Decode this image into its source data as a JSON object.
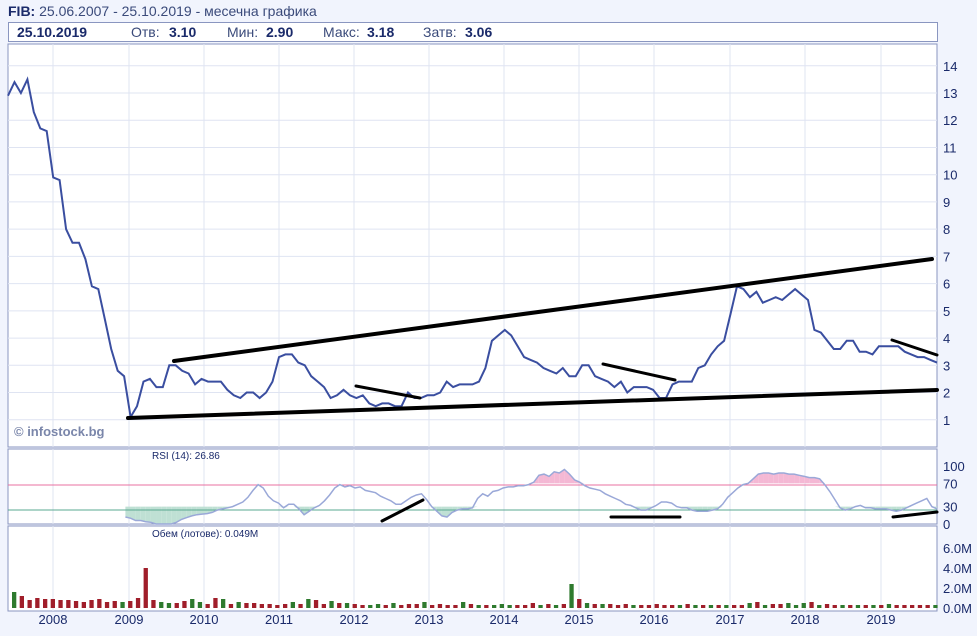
{
  "header": {
    "symbol": "FIB:",
    "range": "25.06.2007 - 25.10.2019 - месечна графика"
  },
  "info_bar": {
    "date": "25.10.2019",
    "open_label": "Отв:",
    "open": "3.10",
    "min_label": "Мин:",
    "min": "2.90",
    "max_label": "Макс:",
    "max": "3.18",
    "close_label": "Затв:",
    "close": "3.06"
  },
  "watermark": "© infostock.bg",
  "rsi_label": "RSI (14): 26.86",
  "volume_label": "Обем (лотове): 0.049M",
  "colors": {
    "price_line": "#3a4ea0",
    "rsi_70": "#e870a0",
    "rsi_30": "#58a890",
    "vol_up": "#2e7a2e",
    "vol_down": "#a01e2a",
    "trend": "#000000"
  },
  "chart_data": [
    {
      "type": "line",
      "title": "",
      "x_axis": [
        "2008",
        "2009",
        "2010",
        "2011",
        "2012",
        "2013",
        "2014",
        "2015",
        "2016",
        "2017",
        "2018",
        "2019"
      ],
      "y_ticks": [
        "1",
        "2",
        "3",
        "4",
        "5",
        "6",
        "7",
        "8",
        "9",
        "10",
        "11",
        "12",
        "13",
        "14"
      ],
      "ylim": [
        0,
        14.8
      ],
      "series": [
        {
          "values": [
            12.9,
            13.4,
            13.0,
            13.5,
            12.3,
            11.7,
            11.6,
            9.9,
            9.8,
            8.0,
            7.5,
            7.5,
            6.9,
            5.9,
            5.8,
            4.7,
            3.6,
            2.8,
            2.6,
            1.1,
            1.5,
            2.4,
            2.5,
            2.2,
            2.2,
            3.0,
            3.0,
            2.8,
            2.7,
            2.3,
            2.5,
            2.4,
            2.4,
            2.4,
            2.1,
            1.9,
            1.8,
            2.0,
            2.0,
            1.8,
            2.0,
            2.4,
            3.3,
            3.4,
            3.4,
            3.1,
            3.0,
            2.6,
            2.4,
            2.2,
            1.8,
            1.9,
            2.1,
            1.9,
            1.8,
            1.9,
            1.6,
            1.5,
            1.6,
            1.6,
            1.5,
            1.5,
            2.0,
            1.8,
            1.8,
            1.9,
            1.9,
            2.0,
            2.4,
            2.2,
            2.3,
            2.3,
            2.3,
            2.4,
            2.9,
            3.9,
            4.1,
            4.3,
            4.1,
            3.7,
            3.3,
            3.2,
            3.1,
            2.9,
            2.8,
            2.7,
            2.9,
            2.6,
            2.6,
            3.0,
            3.0,
            2.6,
            2.5,
            2.4,
            2.2,
            2.4,
            2.0,
            2.2,
            2.2,
            2.2,
            2.1,
            1.8,
            1.8,
            2.3,
            2.4,
            2.4,
            2.4,
            2.9,
            3.0,
            3.4,
            3.7,
            3.9,
            4.9,
            5.9,
            5.8,
            5.5,
            5.7,
            5.3,
            5.4,
            5.5,
            5.4,
            5.6,
            5.8,
            5.6,
            5.4,
            4.3,
            4.2,
            3.9,
            3.6,
            3.6,
            3.9,
            3.9,
            3.5,
            3.5,
            3.4,
            3.7,
            3.7,
            3.7,
            3.7,
            3.5,
            3.4,
            3.3,
            3.3,
            3.2,
            3.1
          ]
        }
      ]
    },
    {
      "type": "line",
      "title": "RSI (14): 26.86",
      "y_ticks": [
        "0",
        "30",
        "70",
        "100"
      ],
      "ylim": [
        0,
        100
      ],
      "series": [
        {
          "values": [
            null,
            null,
            null,
            null,
            null,
            null,
            null,
            null,
            null,
            null,
            null,
            null,
            null,
            null,
            null,
            null,
            null,
            null,
            null,
            null,
            null,
            null,
            null,
            12,
            10,
            6,
            6,
            4,
            3,
            0,
            0,
            0,
            0,
            3,
            8,
            11,
            14,
            16,
            17,
            18,
            20,
            24,
            26,
            28,
            30,
            34,
            38,
            46,
            58,
            68,
            62,
            48,
            40,
            36,
            28,
            34,
            34,
            26,
            16,
            22,
            28,
            32,
            40,
            50,
            62,
            68,
            64,
            66,
            62,
            64,
            58,
            56,
            54,
            48,
            44,
            40,
            34,
            34,
            40,
            46,
            50,
            52,
            42,
            30,
            22,
            14,
            12,
            20,
            24,
            26,
            26,
            28,
            44,
            52,
            48,
            56,
            58,
            62,
            64,
            64,
            66,
            66,
            68,
            72,
            84,
            86,
            82,
            90,
            88,
            94,
            86,
            76,
            72,
            66,
            62,
            60,
            58,
            52,
            48,
            44,
            40,
            34,
            32,
            28,
            24,
            24,
            28,
            32,
            38,
            38,
            36,
            30,
            28,
            28,
            24,
            22,
            22,
            22,
            24,
            26,
            34,
            46,
            54,
            62,
            68,
            70,
            78,
            86,
            88,
            88,
            86,
            88,
            88,
            86,
            86,
            84,
            82,
            80,
            80,
            78,
            68,
            56,
            42,
            28,
            24,
            26,
            30,
            32,
            28,
            28,
            26,
            26,
            26,
            24,
            22,
            24,
            28,
            32,
            36,
            40,
            44,
            30,
            26
          ]
        }
      ]
    },
    {
      "type": "bar",
      "title": "Обем (лотове): 0.049M",
      "y_ticks": [
        "0.0M",
        "2.0M",
        "4.0M",
        "6.0M"
      ],
      "ylim": [
        0,
        7
      ],
      "values": [
        1.6,
        1.2,
        0.8,
        1.0,
        0.9,
        0.9,
        0.8,
        0.8,
        0.7,
        0.6,
        0.8,
        0.9,
        0.6,
        0.7,
        0.6,
        0.7,
        1.0,
        4.0,
        0.8,
        0.6,
        0.5,
        0.5,
        0.7,
        0.9,
        0.6,
        0.4,
        1.0,
        0.9,
        0.4,
        0.6,
        0.5,
        0.5,
        0.4,
        0.4,
        0.3,
        0.4,
        0.6,
        0.4,
        0.9,
        0.8,
        0.4,
        0.7,
        0.5,
        0.5,
        0.4,
        0.3,
        0.3,
        0.4,
        0.3,
        0.5,
        0.3,
        0.4,
        0.4,
        0.6,
        0.3,
        0.4,
        0.3,
        0.3,
        0.6,
        0.4,
        0.3,
        0.3,
        0.3,
        0.4,
        0.3,
        0.3,
        0.3,
        0.5,
        0.3,
        0.4,
        0.3,
        0.4,
        2.4,
        0.9,
        0.5,
        0.4,
        0.4,
        0.4,
        0.3,
        0.4,
        0.3,
        0.3,
        0.3,
        0.4,
        0.3,
        0.3,
        0.3,
        0.4,
        0.3,
        0.3,
        0.3,
        0.3,
        0.3,
        0.3,
        0.3,
        0.5,
        0.6,
        0.3,
        0.4,
        0.4,
        0.5,
        0.3,
        0.5,
        0.6,
        0.3,
        0.4,
        0.3,
        0.3,
        0.3,
        0.3,
        0.3,
        0.3,
        0.3,
        0.4,
        0.3,
        0.3,
        0.3,
        0.3,
        0.3,
        0.3
      ],
      "up_flags": "GRRRRRRRRRRRRRGRRRRGGRRGGRRGRGRRRRRRGRGRRGRGRRGGRGRRRGRRRRGRGRGGGRRRGRGRGRGRGRRRGRRRRRGRGRGRGRRGRGRRGGGRGRRGRGRGRGRRRRRGRR"
    }
  ]
}
